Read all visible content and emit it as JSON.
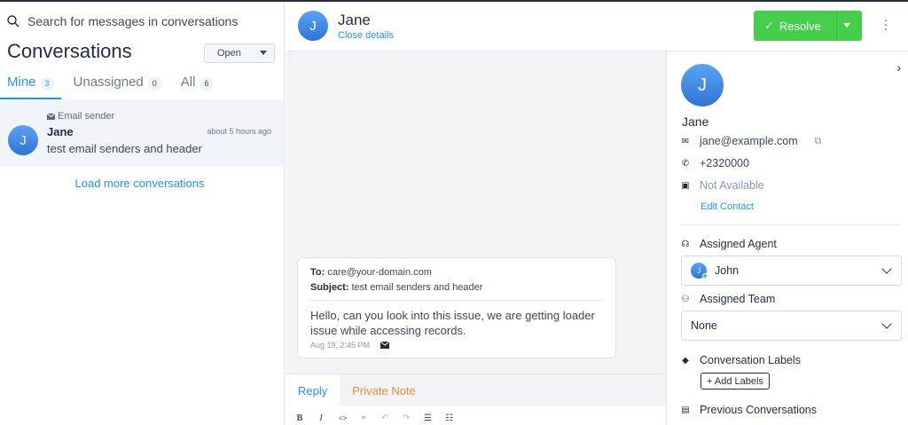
{
  "search": {
    "placeholder": "Search for messages in conversations"
  },
  "conversations": {
    "title": "Conversations",
    "status_filter": "Open",
    "tabs": [
      {
        "label": "Mine",
        "count": "3"
      },
      {
        "label": "Unassigned",
        "count": "0"
      },
      {
        "label": "All",
        "count": "6"
      }
    ],
    "items": [
      {
        "avatar_initial": "J",
        "sender_tag": "Email sender",
        "name": "Jane",
        "time": "about 5 hours ago",
        "preview": "test email senders and header"
      }
    ],
    "load_more": "Load more conversations"
  },
  "header": {
    "avatar_initial": "J",
    "name": "Jane",
    "close_details": "Close details",
    "resolve_label": "Resolve"
  },
  "message": {
    "to_label": "To:",
    "to_value": "care@your-domain.com",
    "subject_label": "Subject:",
    "subject_value": "test email senders and header",
    "body": "Hello, can you look into this issue, we are getting loader issue while accessing records.",
    "timestamp": "Aug 19, 2:45 PM"
  },
  "reply": {
    "tabs": [
      {
        "label": "Reply"
      },
      {
        "label": "Private Note"
      }
    ],
    "tools": [
      "B",
      "I",
      "<>"
    ]
  },
  "contact": {
    "avatar_initial": "J",
    "name": "Jane",
    "email": "jane@example.com",
    "phone": "+2320000",
    "company": "Not Available",
    "edit_label": "Edit Contact"
  },
  "sidebar": {
    "assigned_agent_title": "Assigned Agent",
    "assigned_agent_initial": "J",
    "assigned_agent_value": "John",
    "assigned_team_title": "Assigned Team",
    "assigned_team_value": "None",
    "labels_title": "Conversation Labels",
    "add_labels": "+ Add Labels",
    "previous_title": "Previous Conversations"
  },
  "colors": {
    "accent": "#1f93ff",
    "resolve": "#44ce4b",
    "private_note": "#f28b2b"
  }
}
